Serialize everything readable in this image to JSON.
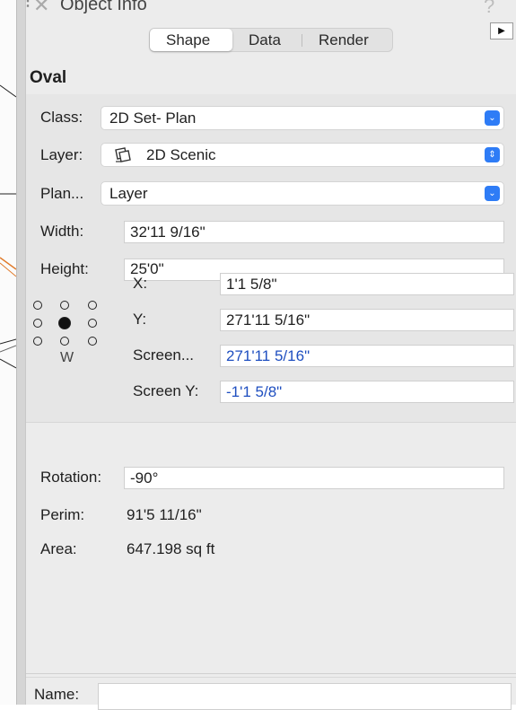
{
  "panel": {
    "title": "Object Info",
    "help_label": "?",
    "close_label": "✕"
  },
  "tabs": [
    {
      "label": "Shape",
      "active": true
    },
    {
      "label": "Data",
      "active": false
    },
    {
      "label": "Render",
      "active": false
    }
  ],
  "object_type": "Oval",
  "fields": {
    "class": {
      "label": "Class:",
      "value": "2D Set-  Plan"
    },
    "layer": {
      "label": "Layer:",
      "value": "2D Scenic"
    },
    "plane": {
      "label": "Plan...",
      "value": "Layer"
    },
    "width": {
      "label": "Width:",
      "value": "32'11 9/16\""
    },
    "height": {
      "label": "Height:",
      "value": "25'0\""
    },
    "x": {
      "label": "X:",
      "value": "1'1 5/8\""
    },
    "y": {
      "label": "Y:",
      "value": "271'11 5/16\""
    },
    "screen_x": {
      "label": "Screen...",
      "value": "271'11 5/16\""
    },
    "screen_y": {
      "label": "Screen Y:",
      "value": "-1'1 5/8\""
    },
    "rotation": {
      "label": "Rotation:",
      "value": "-90°"
    },
    "perim": {
      "label": "Perim:",
      "value": "91'5 11/16\""
    },
    "area": {
      "label": "Area:",
      "value": "647.198 sq ft"
    },
    "name": {
      "label": "Name:",
      "value": ""
    }
  },
  "anchor_caption": "W",
  "colors": {
    "accent": "#2e7cf6",
    "screen_value": "#1f4fc0",
    "panel_bg": "#ececec"
  },
  "icons": {
    "layer_icon": "layer-stack-icon",
    "popup_chevron": "chevron-updown-icon"
  }
}
